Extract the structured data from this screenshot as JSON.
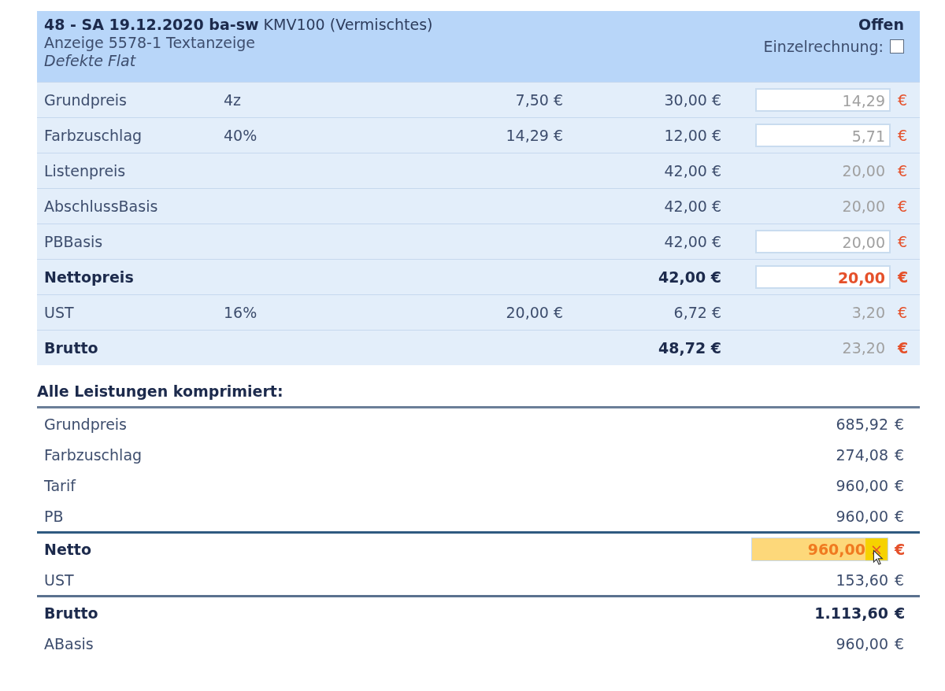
{
  "header": {
    "title": "**48 - SA 19.12.2020 ba-sw** KMV100 (Vermischtes)",
    "status": "Offen",
    "subtitle": "Anzeige 5578-1 Textanzeige",
    "note": "Defekte Flat",
    "checkbox": {
      "label": "Einzelrechnung:",
      "checked": false
    }
  },
  "rows": [
    {
      "label": "Grundpreis",
      "column_2": "4z",
      "column_3": "7,50 €",
      "column_4": "30,00 €",
      "value": "14,29",
      "kind": "input",
      "bold": false,
      "currency": "€"
    },
    {
      "label": "Farbzuschlag",
      "column_2": "40%",
      "column_3": "14,29 €",
      "column_4": "12,00 €",
      "value": "5,71",
      "kind": "input",
      "bold": false,
      "currency": "€"
    },
    {
      "label": "Listenpreis",
      "column_4": "42,00 €",
      "value": "20,00",
      "kind": "text",
      "bold": false,
      "currency": "€"
    },
    {
      "label": "AbschlussBasis",
      "column_4": "42,00 €",
      "value": "20,00",
      "kind": "text",
      "bold": false,
      "currency": "€"
    },
    {
      "label": "PBBasis",
      "column_4": "42,00 €",
      "value": "20,00",
      "kind": "input",
      "bold": false,
      "currency": "€"
    },
    {
      "label": "Nettopreis",
      "column_4": "42,00 €",
      "value": "20,00",
      "kind": "input",
      "bold": true,
      "currency": "€"
    },
    {
      "label": "UST",
      "column_2": "16%",
      "column_3": "20,00 €",
      "column_4": "6,72 €",
      "value": "3,20",
      "kind": "text",
      "bold": false,
      "currency": "€"
    },
    {
      "label": "Brutto",
      "column_4": "48,72 €",
      "value": "23,20",
      "kind": "text",
      "bold": true,
      "currency": "€"
    }
  ],
  "summary": {
    "title": "Alle Leistungen komprimiert:",
    "rows": [
      {
        "label": "Grundpreis",
        "amount": "685,92",
        "currency": "€",
        "kind": "text",
        "bold": false,
        "rule_above": false
      },
      {
        "label": "Farbzuschlag",
        "amount": "274,08",
        "currency": "€",
        "kind": "text",
        "bold": false,
        "rule_above": false
      },
      {
        "label": "Tarif",
        "amount": "960,00",
        "currency": "€",
        "kind": "text",
        "bold": false,
        "rule_above": false
      },
      {
        "label": "PB",
        "amount": "960,00",
        "currency": "€",
        "kind": "text",
        "bold": false,
        "rule_above": false
      },
      {
        "label": "Netto",
        "amount": "960,00",
        "currency": "€",
        "kind": "edit",
        "clear": "×",
        "bold": true,
        "rule_above": true
      },
      {
        "label": "UST",
        "amount": "153,60",
        "currency": "€",
        "kind": "text",
        "bold": false,
        "rule_above": false
      },
      {
        "label": "Brutto",
        "amount": "1.113,60",
        "currency": "€",
        "kind": "text",
        "bold": true,
        "rule_above": true
      },
      {
        "label": "ABasis",
        "amount": "960,00",
        "currency": "€",
        "kind": "text",
        "bold": false,
        "rule_above": false
      }
    ]
  }
}
